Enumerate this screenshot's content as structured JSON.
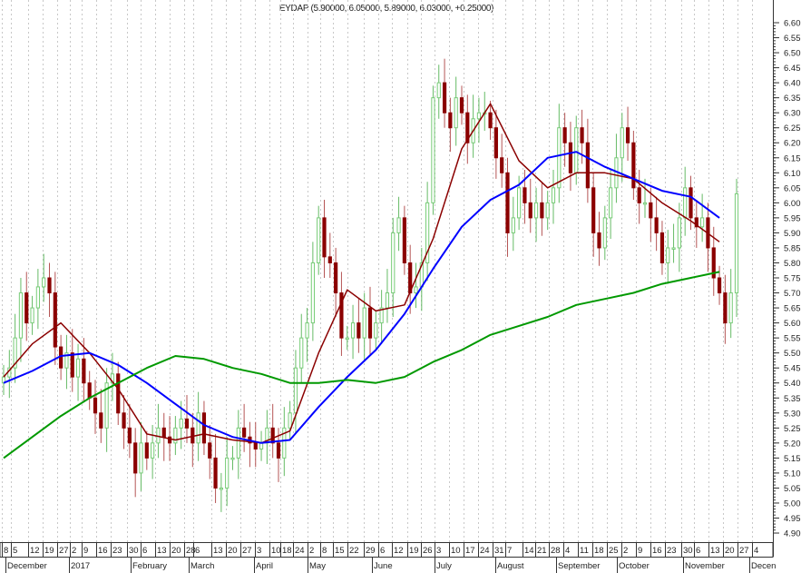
{
  "chart_data": {
    "type": "candlestick",
    "title": "EYDAP (5.90000, 6.05000, 5.89000, 6.03000, +0.25000)",
    "ylim": [
      4.9,
      6.6
    ],
    "ytick_step": 0.05,
    "grid": "vertical dotted",
    "colors": {
      "up": "#77cc77",
      "down": "#8b0000",
      "ma_short": "#8b0000",
      "ma_mid": "#0000ff",
      "ma_long": "#009900",
      "axis": "#333333"
    },
    "closes": [
      5.42,
      5.45,
      5.55,
      5.7,
      5.6,
      5.65,
      5.72,
      5.75,
      5.7,
      5.52,
      5.45,
      5.5,
      5.42,
      5.48,
      5.4,
      5.35,
      5.3,
      5.25,
      5.4,
      5.43,
      5.3,
      5.25,
      5.2,
      5.1,
      5.2,
      5.15,
      5.2,
      5.25,
      5.22,
      5.2,
      5.25,
      5.28,
      5.25,
      5.2,
      5.3,
      5.2,
      5.15,
      5.05,
      5.05,
      5.15,
      5.15,
      5.25,
      5.22,
      5.2,
      5.18,
      5.2,
      5.25,
      5.2,
      5.15,
      5.25,
      5.3,
      5.45,
      5.55,
      5.6,
      5.8,
      5.95,
      5.82,
      5.8,
      5.7,
      5.55,
      5.55,
      5.6,
      5.55,
      5.65,
      5.55,
      5.6,
      5.65,
      5.7,
      5.9,
      5.95,
      5.8,
      5.7,
      5.72,
      5.8,
      6.0,
      6.35,
      6.4,
      6.3,
      6.25,
      6.35,
      6.3,
      6.2,
      6.28,
      6.3,
      6.3,
      6.25,
      6.15,
      6.1,
      5.9,
      5.95,
      6.05,
      6.0,
      5.95,
      6.0,
      5.95,
      6.0,
      6.05,
      6.25,
      6.2,
      6.1,
      6.25,
      6.2,
      6.05,
      5.9,
      5.85,
      5.95,
      6.05,
      6.15,
      6.25,
      6.2,
      6.05,
      6.0,
      6.0,
      5.95,
      5.9,
      5.8,
      5.85,
      5.85,
      5.95,
      6.05,
      5.95,
      5.92,
      5.95,
      5.85,
      5.75,
      5.7,
      5.6,
      5.7,
      6.03
    ],
    "moving_averages": [
      {
        "name": "short MA",
        "color_key": "ma_short",
        "sample_every": 5,
        "values": [
          5.42,
          5.53,
          5.6,
          5.5,
          5.38,
          5.23,
          5.21,
          5.23,
          5.21,
          5.2,
          5.24,
          5.5,
          5.71,
          5.64,
          5.66,
          5.88,
          6.18,
          6.33,
          6.14,
          6.05,
          6.1,
          6.1,
          6.08,
          6.0,
          5.94,
          5.87
        ]
      },
      {
        "name": "mid MA",
        "color_key": "ma_mid",
        "sample_every": 5,
        "values": [
          5.4,
          5.44,
          5.49,
          5.5,
          5.46,
          5.4,
          5.33,
          5.26,
          5.22,
          5.2,
          5.21,
          5.32,
          5.42,
          5.51,
          5.63,
          5.78,
          5.92,
          6.01,
          6.06,
          6.15,
          6.17,
          6.12,
          6.08,
          6.04,
          6.02,
          5.95
        ]
      },
      {
        "name": "long MA",
        "color_key": "ma_long",
        "sample_every": 5,
        "values": [
          5.15,
          5.22,
          5.29,
          5.35,
          5.4,
          5.45,
          5.49,
          5.48,
          5.45,
          5.43,
          5.4,
          5.4,
          5.41,
          5.4,
          5.42,
          5.47,
          5.51,
          5.56,
          5.59,
          5.62,
          5.66,
          5.68,
          5.7,
          5.73,
          5.75,
          5.77
        ]
      }
    ],
    "ytick_labels": [
      "6.60",
      "6.55",
      "6.50",
      "6.45",
      "6.40",
      "6.35",
      "6.30",
      "6.25",
      "6.20",
      "6.15",
      "6.10",
      "6.05",
      "6.00",
      "5.95",
      "5.90",
      "5.85",
      "5.80",
      "5.75",
      "5.70",
      "5.65",
      "5.60",
      "5.55",
      "5.50",
      "5.45",
      "5.40",
      "5.35",
      "5.30",
      "5.25",
      "5.20",
      "5.15",
      "5.10",
      "5.05",
      "5.00",
      "4.95",
      "4.90"
    ],
    "x_day_labels": [
      "8",
      "5",
      "12",
      "19",
      "27",
      "2",
      "9",
      "16",
      "23",
      "30",
      "6",
      "13",
      "20",
      "28",
      "6",
      "13",
      "20",
      "27",
      "3",
      "10",
      "18",
      "24",
      "2",
      "8",
      "15",
      "22",
      "29",
      "6",
      "12",
      "19",
      "26",
      "3",
      "10",
      "17",
      "24",
      "31",
      "7",
      "14",
      "21",
      "28",
      "4",
      "11",
      "18",
      "25",
      "2",
      "9",
      "16",
      "23",
      "30",
      "6",
      "13",
      "20",
      "27",
      "4"
    ],
    "x_month_labels": [
      "December",
      "2017",
      "February",
      "March",
      "April",
      "May",
      "June",
      "July",
      "August",
      "September",
      "October",
      "November",
      "Decen"
    ]
  }
}
